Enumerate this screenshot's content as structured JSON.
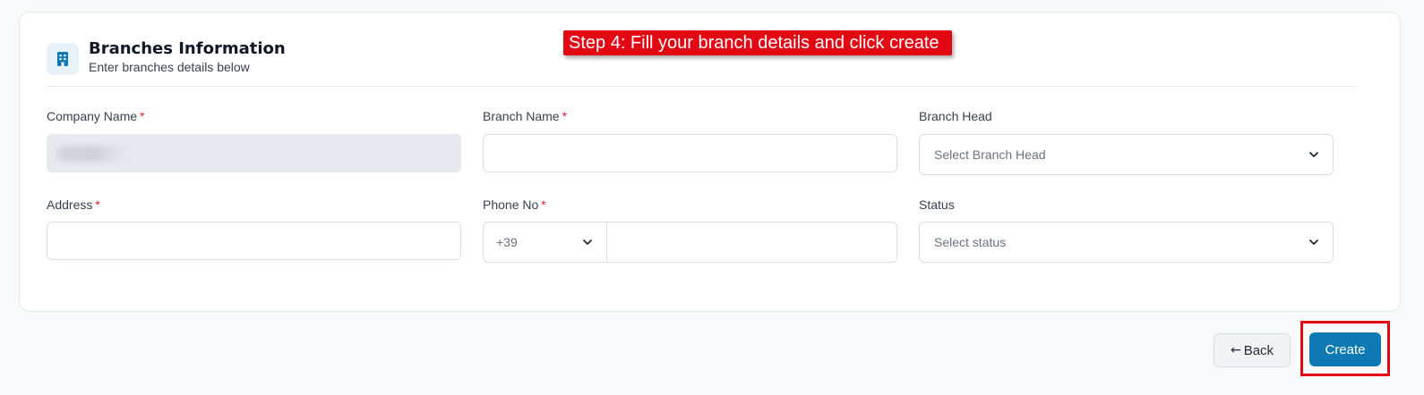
{
  "header": {
    "icon": "building-icon",
    "title": "Branches Information",
    "subtitle": "Enter branches details below"
  },
  "annotation": {
    "step_text": "Step 4: Fill your branch details and click create",
    "color": "#e30613"
  },
  "form": {
    "company_name": {
      "label": "Company Name",
      "required_mark": "*",
      "value": ""
    },
    "branch_name": {
      "label": "Branch Name",
      "required_mark": "*",
      "value": ""
    },
    "branch_head": {
      "label": "Branch Head",
      "placeholder": "Select Branch Head"
    },
    "address": {
      "label": "Address",
      "required_mark": "*",
      "value": ""
    },
    "phone": {
      "label": "Phone No",
      "required_mark": "*",
      "country_code": "+39",
      "value": ""
    },
    "status": {
      "label": "Status",
      "placeholder": "Select status"
    }
  },
  "actions": {
    "back_label": "Back",
    "back_icon": "arrow-left-icon",
    "create_label": "Create",
    "accent_color": "#0e79b2"
  }
}
